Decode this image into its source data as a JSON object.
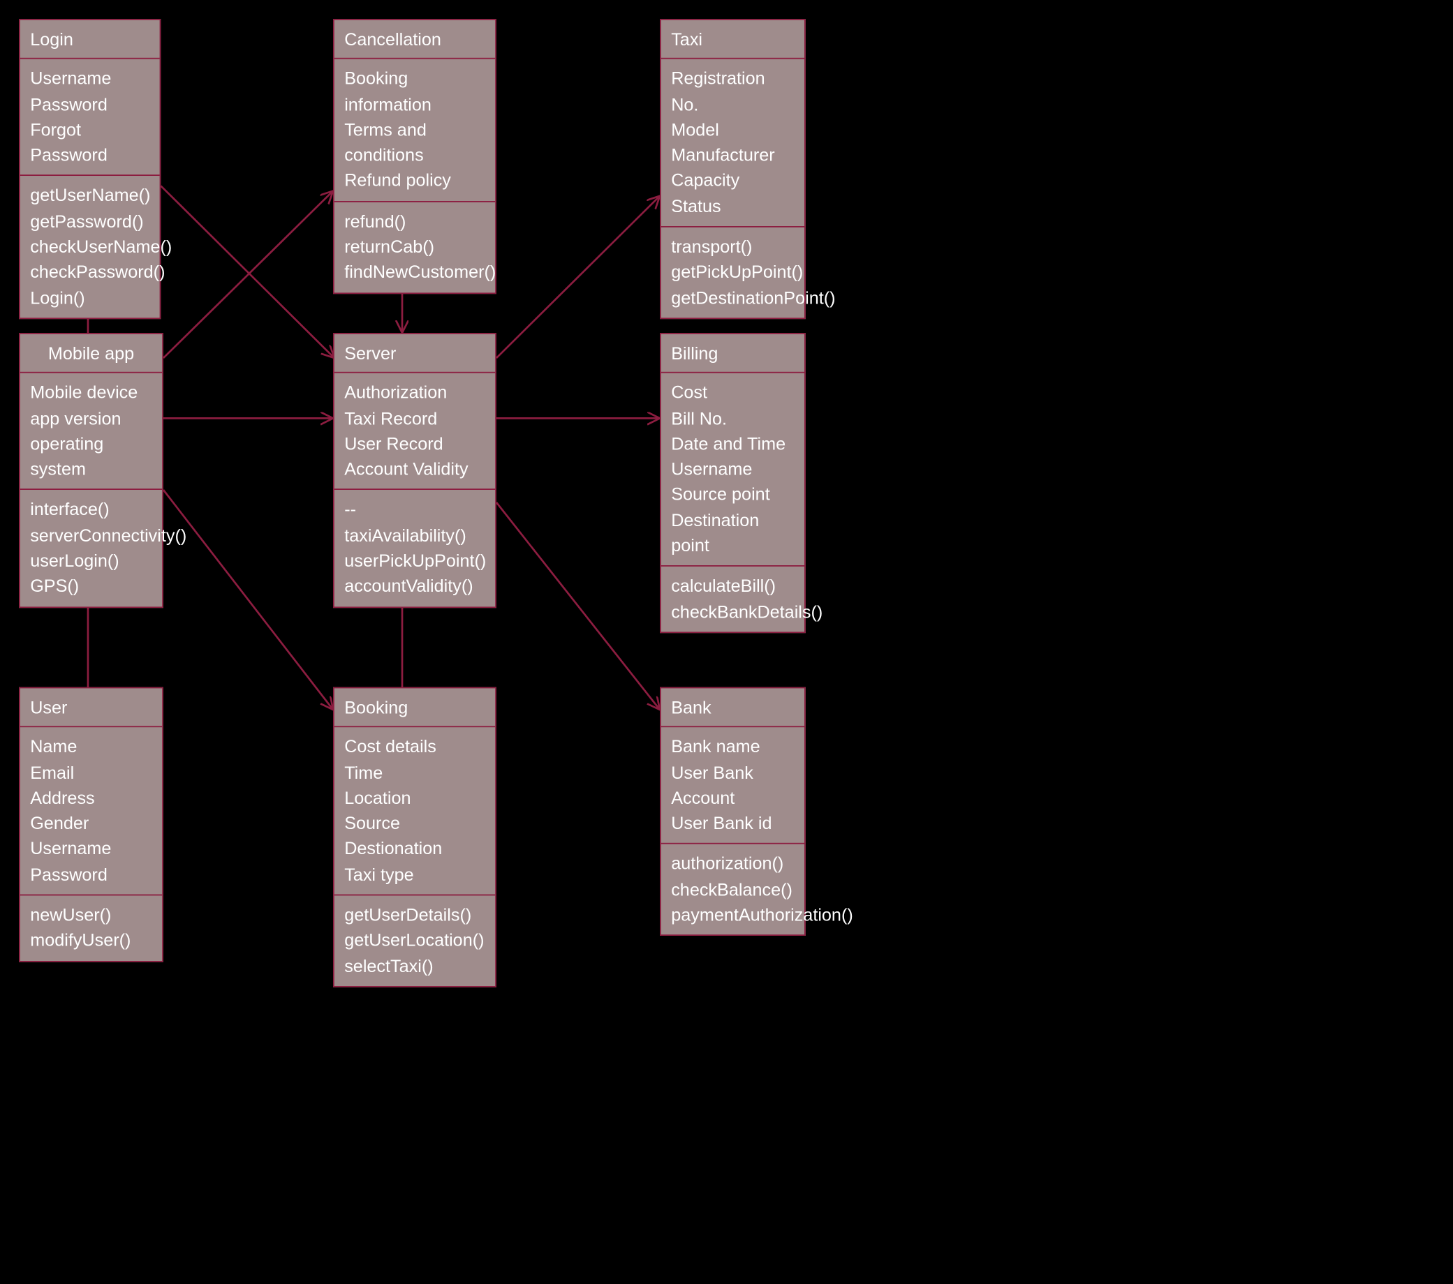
{
  "classes": {
    "login": {
      "title": "Login",
      "attrs": [
        "Username",
        "Password",
        "Forgot Password"
      ],
      "ops": [
        "getUserName()",
        "getPassword()",
        "checkUserName()",
        "checkPassword()",
        "Login()"
      ]
    },
    "cancellation": {
      "title": "Cancellation",
      "attrs": [
        "Booking information",
        "Terms and conditions",
        "Refund policy"
      ],
      "ops": [
        "refund()",
        "returnCab()",
        "findNewCustomer()"
      ]
    },
    "taxi": {
      "title": "Taxi",
      "attrs": [
        "Registration No.",
        "Model",
        "Manufacturer",
        "Capacity",
        "Status"
      ],
      "ops": [
        "transport()",
        "getPickUpPoint()",
        "getDestinationPoint()"
      ]
    },
    "mobileapp": {
      "title": "Mobile app",
      "attrs": [
        "Mobile device",
        "app version",
        "operating system"
      ],
      "ops": [
        "interface()",
        "serverConnectivity()",
        "userLogin()",
        "GPS()"
      ]
    },
    "server": {
      "title": "Server",
      "attrs": [
        "Authorization",
        "Taxi Record",
        "User Record",
        "Account Validity"
      ],
      "ops": [
        "--",
        "taxiAvailability()",
        "userPickUpPoint()",
        "accountValidity()"
      ]
    },
    "billing": {
      "title": "Billing",
      "attrs": [
        "Cost",
        "Bill No.",
        "Date and Time",
        "Username",
        "Source point",
        "Destination point"
      ],
      "ops": [
        "calculateBill()",
        "checkBankDetails()"
      ]
    },
    "user": {
      "title": "User",
      "attrs": [
        "Name",
        "Email",
        "Address",
        "Gender",
        "Username",
        "Password"
      ],
      "ops": [
        "newUser()",
        "modifyUser()"
      ]
    },
    "booking": {
      "title": "Booking",
      "attrs": [
        "Cost details",
        "Time",
        "Location",
        "Source",
        "Destionation",
        "Taxi type"
      ],
      "ops": [
        "getUserDetails()",
        "getUserLocation()",
        "selectTaxi()"
      ]
    },
    "bank": {
      "title": "Bank",
      "attrs": [
        "Bank name",
        "User Bank Account",
        "User Bank id"
      ],
      "ops": [
        "authorization()",
        "checkBalance()",
        "paymentAuthorization()"
      ]
    }
  }
}
